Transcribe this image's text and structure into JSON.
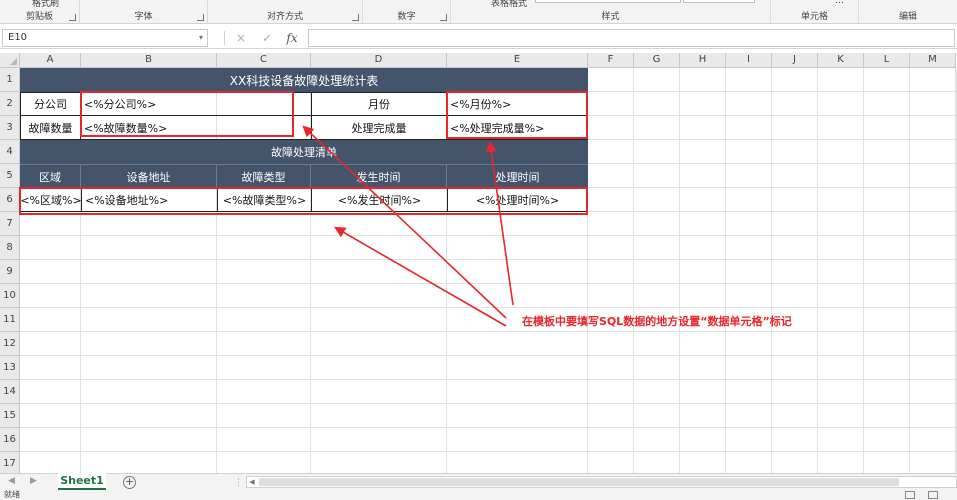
{
  "ribbon": {
    "groups": [
      {
        "label": "剪贴板"
      },
      {
        "label": "字体"
      },
      {
        "label": "对齐方式"
      },
      {
        "label": "数字"
      },
      {
        "label": "样式"
      },
      {
        "label": "单元格"
      },
      {
        "label": "编辑"
      }
    ],
    "format_painter_label": "格式刷",
    "table_format_label": "表格格式",
    "cell_dropdown_label": "…"
  },
  "formula_bar": {
    "name_box": "E10",
    "cancel_icon": "×",
    "enter_icon": "✓",
    "fx_label": "fx",
    "formula_value": ""
  },
  "columns": [
    "A",
    "B",
    "C",
    "D",
    "E",
    "F",
    "G",
    "H",
    "I",
    "J",
    "K",
    "L",
    "M"
  ],
  "rows": [
    "1",
    "2",
    "3",
    "4",
    "5",
    "6",
    "7",
    "8",
    "9",
    "10",
    "11",
    "12",
    "13",
    "14",
    "15",
    "16",
    "17"
  ],
  "report": {
    "title": "XX科技设备故障处理统计表",
    "branch_label": "分公司",
    "branch_value": "<%分公司%>",
    "month_label": "月份",
    "month_value": "<%月份%>",
    "fault_count_label": "故障数量",
    "fault_count_value": "<%故障数量%>",
    "completed_label": "处理完成量",
    "completed_value": "<%处理完成量%>",
    "list_title": "故障处理清单",
    "headers": [
      "区域",
      "设备地址",
      "故障类型",
      "发生时间",
      "处理时间"
    ],
    "row": [
      "<%区域%>",
      "<%设备地址%>",
      "<%故障类型%>",
      "<%发生时间%>",
      "<%处理时间%>"
    ]
  },
  "annotation": "在模板中要填写SQL数据的地方设置“数据单元格”标记",
  "colors": {
    "header_fill": "#44546a",
    "annotation_red": "#e8262c",
    "sheet_tab_green": "#217346"
  },
  "sheet_tabs": {
    "active": "Sheet1",
    "add_label": "+"
  },
  "status_bar": {
    "text": "就绪"
  }
}
